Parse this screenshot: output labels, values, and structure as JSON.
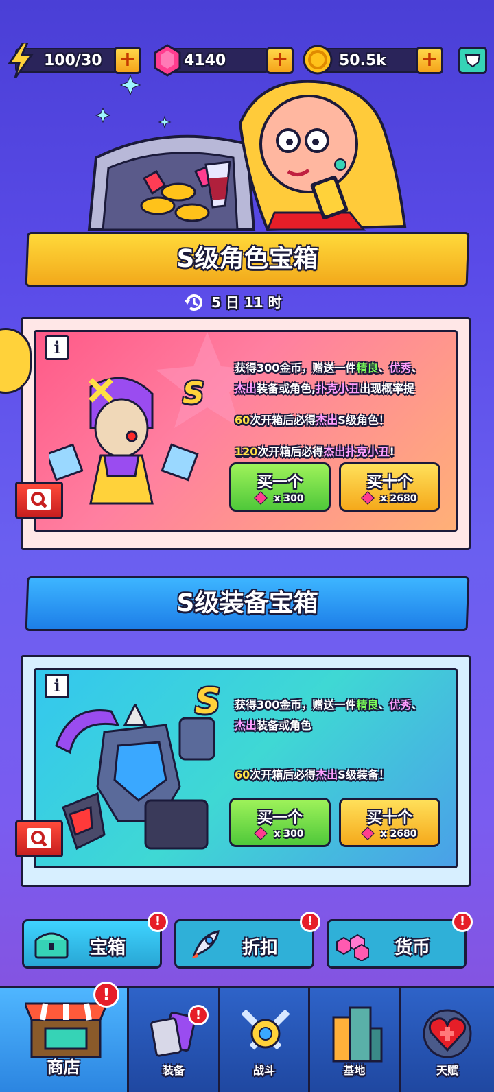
{
  "resources": {
    "energy": "100/30",
    "gems": "4140",
    "coins": "50.5k"
  },
  "chests": [
    {
      "title": "S级角色宝箱",
      "timer": "5 日 11 时",
      "grade": "S",
      "desc_line1_a": "获得300金币，赠送一件",
      "desc_line1_good": "精良",
      "desc_line1_sep": "、",
      "desc_line1_excellent": "优秀",
      "desc_line1_end": "、",
      "desc_line2_epic": "杰出",
      "desc_line2_a": "装备或角色,",
      "desc_line2_clown": "扑克小丑",
      "desc_line2_b": "出现概率提",
      "guarantee1_num": "60",
      "guarantee1_a": "次开箱后必得",
      "guarantee1_epic": "杰出",
      "guarantee1_b": "S级角色！",
      "guarantee2_num": "120",
      "guarantee2_a": "次开箱后必得",
      "guarantee2_epic": "杰出扑克小丑",
      "guarantee2_b": "!",
      "buy_one": "买一个",
      "buy_one_price": "x 300",
      "buy_ten": "买十个",
      "buy_ten_price": "x 2680"
    },
    {
      "title": "S级装备宝箱",
      "grade": "S",
      "desc_line1_a": "获得300金币，赠送一件",
      "desc_line1_good": "精良",
      "desc_line1_sep": "、",
      "desc_line1_excellent": "优秀",
      "desc_line1_end": "、",
      "desc_line2_epic": "杰出",
      "desc_line2_a": "装备或角色",
      "guarantee1_num": "60",
      "guarantee1_a": "次开箱后必得",
      "guarantee1_epic": "杰出",
      "guarantee1_b": "S级装备！",
      "buy_one": "买一个",
      "buy_one_price": "x 300",
      "buy_ten": "买十个",
      "buy_ten_price": "x 2680"
    }
  ],
  "info_icon": "i",
  "categories": [
    {
      "label": "宝箱",
      "badge": "!"
    },
    {
      "label": "折扣",
      "badge": "!"
    },
    {
      "label": "货币",
      "badge": "!"
    }
  ],
  "nav": [
    {
      "label": "商店",
      "badge": "!"
    },
    {
      "label": "装备",
      "badge": "!"
    },
    {
      "label": "战斗"
    },
    {
      "label": "基地"
    },
    {
      "label": "天赋"
    }
  ],
  "colors": {
    "good": "#7cff5a",
    "excellent": "#ff9dff",
    "highlight": "#ffe044",
    "badge_red": "#e61e28"
  }
}
